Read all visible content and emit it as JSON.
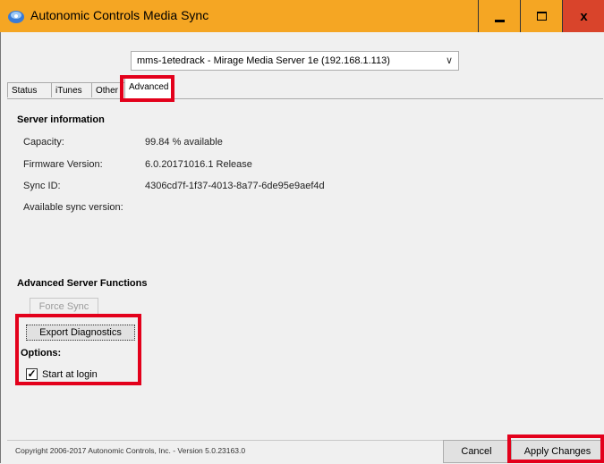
{
  "window": {
    "title": "Autonomic Controls Media Sync",
    "icon": "app-logo-icon",
    "controls": {
      "minimize": "minimize",
      "maximize": "maximize",
      "close": "x"
    }
  },
  "server_select": {
    "value": "mms-1etedrack - Mirage Media Server 1e (192.168.1.113)"
  },
  "tabs": [
    {
      "label": "Status"
    },
    {
      "label": "iTunes"
    },
    {
      "label": "Other"
    },
    {
      "label": "Advanced"
    }
  ],
  "server_info": {
    "heading": "Server information",
    "rows": [
      {
        "label": "Capacity:",
        "value": "99.84 % available"
      },
      {
        "label": "Firmware Version:",
        "value": "6.0.20171016.1 Release"
      },
      {
        "label": "Sync ID:",
        "value": "4306cd7f-1f37-4013-8a77-6de95e9aef4d"
      },
      {
        "label": "Available sync version:",
        "value": ""
      }
    ]
  },
  "advanced": {
    "heading": "Advanced Server Functions",
    "force_sync": "Force Sync",
    "export_diagnostics": "Export Diagnostics"
  },
  "options": {
    "heading": "Options:",
    "start_at_login": {
      "label": "Start at login",
      "checked": true
    }
  },
  "footer": {
    "copyright": "Copyright 2006-2017 Autonomic Controls, Inc. - Version 5.0.23163.0",
    "cancel": "Cancel",
    "apply": "Apply Changes"
  },
  "colors": {
    "titlebar": "#f5a623",
    "highlight": "#e3001b",
    "close": "#d9442b"
  }
}
